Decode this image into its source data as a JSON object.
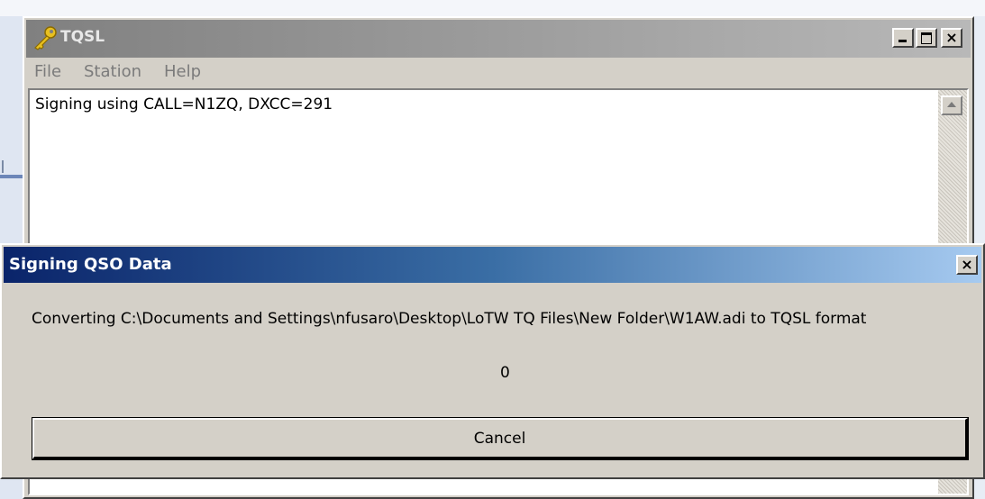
{
  "main_window": {
    "title": "TQSL",
    "icon": "key-icon",
    "menu": [
      "File",
      "Station",
      "Help"
    ],
    "log_text": "Signing using CALL=N1ZQ, DXCC=291"
  },
  "dialog": {
    "title": "Signing QSO Data",
    "message": "Converting C:\\Documents and Settings\\nfusaro\\Desktop\\LoTW TQ Files\\New Folder\\W1AW.adi to TQSL format",
    "value": "0",
    "cancel_label": "Cancel",
    "close_glyph": "×"
  },
  "colors": {
    "dialog_title_start": "#0a246a",
    "dialog_title_end": "#a6caf0",
    "window_face": "#d4d0c8"
  }
}
